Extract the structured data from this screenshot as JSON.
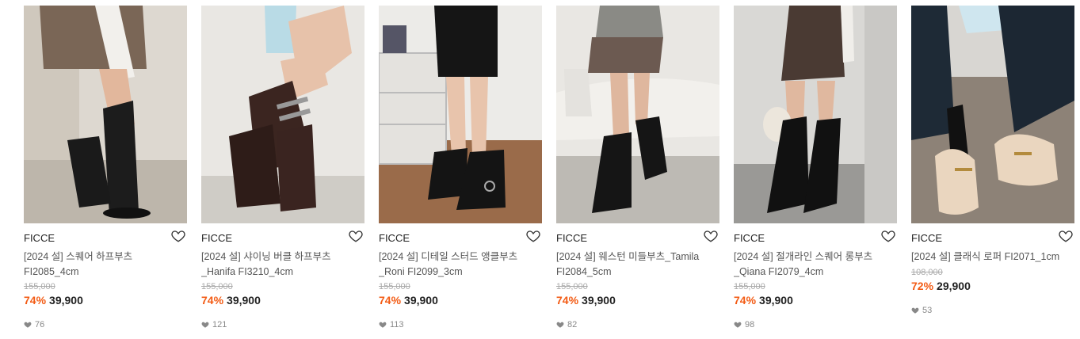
{
  "products": [
    {
      "brand": "FICCE",
      "title": "[2024 설] 스퀘어 하프부츠FI2085_4cm",
      "original_price": "155,000",
      "discount": "74%",
      "price": "39,900",
      "likes": "76"
    },
    {
      "brand": "FICCE",
      "title": "[2024 설] 샤이닝 버클 하프부츠_Hanifa FI3210_4cm",
      "original_price": "155,000",
      "discount": "74%",
      "price": "39,900",
      "likes": "121"
    },
    {
      "brand": "FICCE",
      "title": "[2024 설] 디테일 스터드 앵클부츠_Roni FI2099_3cm",
      "original_price": "155,000",
      "discount": "74%",
      "price": "39,900",
      "likes": "113"
    },
    {
      "brand": "FICCE",
      "title": "[2024 설] 웨스턴 미들부츠_Tamila FI2084_5cm",
      "original_price": "155,000",
      "discount": "74%",
      "price": "39,900",
      "likes": "82"
    },
    {
      "brand": "FICCE",
      "title": "[2024 설] 절개라인 스퀘어 롱부츠_Qiana FI2079_4cm",
      "original_price": "155,000",
      "discount": "74%",
      "price": "39,900",
      "likes": "98"
    },
    {
      "brand": "FICCE",
      "title": "[2024 설] 클래식 로퍼 FI2071_1cm",
      "original_price": "108,000",
      "discount": "72%",
      "price": "29,900",
      "likes": "53"
    }
  ],
  "colors": {
    "discount": "#f35b14",
    "strike": "#aaaaaa",
    "likes": "#888888"
  },
  "icons": {
    "wishlist": "heart-outline-icon",
    "likes": "heart-filled-icon"
  }
}
